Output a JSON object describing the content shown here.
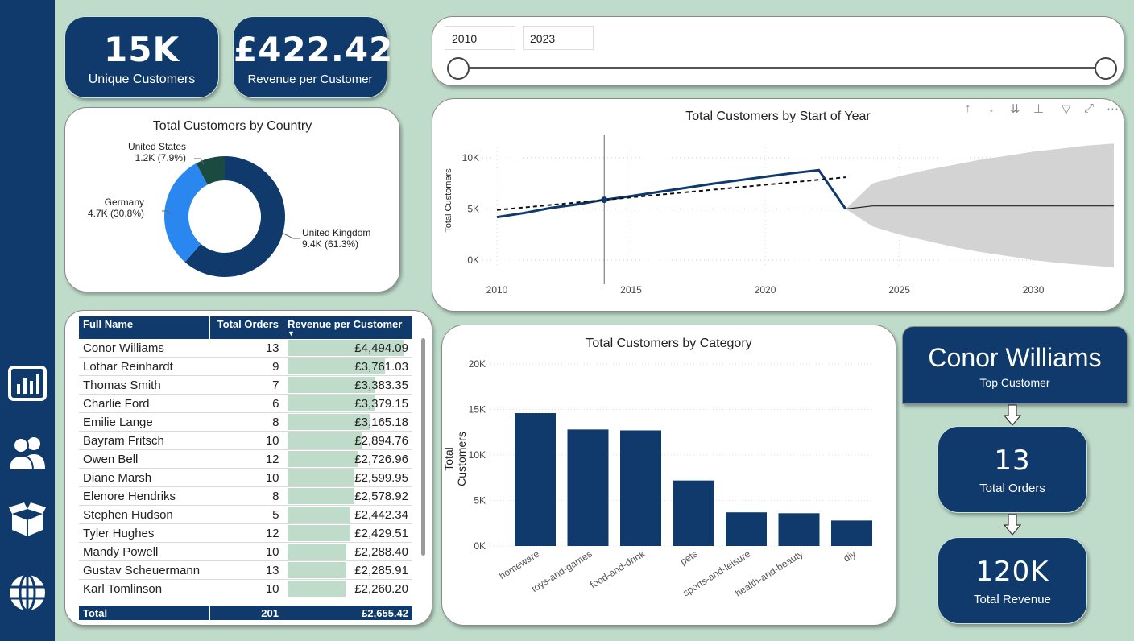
{
  "kpis": {
    "unique_customers": {
      "value": "15K",
      "label": "Unique Customers"
    },
    "revenue_per_customer": {
      "value": "£422.42",
      "label": "Revenue per Customer"
    }
  },
  "slicer": {
    "start": "2010",
    "end": "2023",
    "start_pos": 0.0,
    "end_pos": 1.0
  },
  "donut": {
    "title": "Total Customers by Country",
    "segments": [
      {
        "name": "United Kingdom",
        "label": "9.4K (61.3%)",
        "share": 0.613,
        "color": "#0f3a6b"
      },
      {
        "name": "Germany",
        "label": "4.7K (30.8%)",
        "share": 0.308,
        "color": "#2b87f0"
      },
      {
        "name": "United States",
        "label": "1.2K (7.9%)",
        "share": 0.079,
        "color": "#1a4a40"
      }
    ]
  },
  "line_chart": {
    "title": "Total Customers by Start of Year",
    "ylabel": "Total Customers",
    "yticks": [
      "0K",
      "5K",
      "10K"
    ],
    "xticks": [
      "2010",
      "2015",
      "2020",
      "2025",
      "2030"
    ]
  },
  "table": {
    "headers": [
      "Full Name",
      "Total Orders",
      "Revenue per Customer"
    ],
    "rows": [
      {
        "name": "Conor Williams",
        "orders": "13",
        "revenue": "£4,494.09",
        "rev_value": 4494.09
      },
      {
        "name": "Lothar Reinhardt",
        "orders": "9",
        "revenue": "£3,761.03",
        "rev_value": 3761.03
      },
      {
        "name": "Thomas Smith",
        "orders": "7",
        "revenue": "£3,383.35",
        "rev_value": 3383.35
      },
      {
        "name": "Charlie Ford",
        "orders": "6",
        "revenue": "£3,379.15",
        "rev_value": 3379.15
      },
      {
        "name": "Emilie Lange",
        "orders": "8",
        "revenue": "£3,165.18",
        "rev_value": 3165.18
      },
      {
        "name": "Bayram Fritsch",
        "orders": "10",
        "revenue": "£2,894.76",
        "rev_value": 2894.76
      },
      {
        "name": "Owen Bell",
        "orders": "12",
        "revenue": "£2,726.96",
        "rev_value": 2726.96
      },
      {
        "name": "Diane Marsh",
        "orders": "10",
        "revenue": "£2,599.95",
        "rev_value": 2599.95
      },
      {
        "name": "Elenore Hendriks",
        "orders": "8",
        "revenue": "£2,578.92",
        "rev_value": 2578.92
      },
      {
        "name": "Stephen Hudson",
        "orders": "5",
        "revenue": "£2,442.34",
        "rev_value": 2442.34
      },
      {
        "name": "Tyler Hughes",
        "orders": "12",
        "revenue": "£2,429.51",
        "rev_value": 2429.51
      },
      {
        "name": "Mandy Powell",
        "orders": "10",
        "revenue": "£2,288.40",
        "rev_value": 2288.4
      },
      {
        "name": "Gustav Scheuermann",
        "orders": "13",
        "revenue": "£2,285.91",
        "rev_value": 2285.91
      },
      {
        "name": "Karl Tomlinson",
        "orders": "10",
        "revenue": "£2,260.20",
        "rev_value": 2260.2
      }
    ],
    "total": {
      "label": "Total",
      "orders": "201",
      "revenue": "£2,655.42"
    }
  },
  "bar_chart": {
    "title": "Total Customers by Category",
    "ylabel": "Total Customers",
    "yticks": [
      "0K",
      "5K",
      "10K",
      "15K",
      "20K"
    ]
  },
  "top_customer": {
    "name": "Conor Williams",
    "label": "Top Customer"
  },
  "top_orders": {
    "value": "13",
    "label": "Total Orders"
  },
  "top_revenue": {
    "value": "120K",
    "label": "Total Revenue"
  },
  "icons": [
    "chart-bars-icon",
    "users-icon",
    "box-icon",
    "globe-icon",
    "sort-up-icon",
    "sort-down-icon",
    "expand-all-icon",
    "drill-icon",
    "filter-icon",
    "focus-mode-icon",
    "more-options-icon"
  ],
  "colors": {
    "navy": "#0f3a6b",
    "background": "#bfdccb",
    "blue": "#2b87f0",
    "forecast_band": "#d3d3d3"
  },
  "chart_data": [
    {
      "type": "pie",
      "title": "Total Customers by Country",
      "categories": [
        "United Kingdom",
        "Germany",
        "United States"
      ],
      "values": [
        9400,
        4700,
        1200
      ],
      "percentages": [
        61.3,
        30.8,
        7.9
      ]
    },
    {
      "type": "line",
      "title": "Total Customers by Start of Year",
      "xlabel": "",
      "ylabel": "Total Customers",
      "xlim": [
        2010,
        2033
      ],
      "ylim": [
        -1000,
        12000
      ],
      "series": [
        {
          "x": [
            2010,
            2011,
            2012,
            2013,
            2014,
            2015,
            2016,
            2017,
            2018,
            2019,
            2020,
            2021,
            2022,
            2023
          ],
          "y": [
            4200,
            4600,
            5100,
            5450,
            5900,
            6250,
            6650,
            7050,
            7450,
            7800,
            8150,
            8500,
            8800,
            5000
          ]
        },
        {
          "x": [
            2010,
            2023
          ],
          "y": [
            4900,
            8100
          ]
        },
        {
          "x": [
            2023,
            2024,
            2025,
            2026,
            2027,
            2028,
            2029,
            2030,
            2031,
            2032,
            2033
          ],
          "y": [
            5000,
            5300,
            5300,
            5300,
            5300,
            5300,
            5300,
            5300,
            5300,
            5300,
            5300
          ]
        }
      ],
      "forecast_band": {
        "x": [
          2023,
          2024,
          2025,
          2026,
          2027,
          2028,
          2029,
          2030,
          2031,
          2032,
          2033
        ],
        "upper": [
          5000,
          7500,
          8200,
          8800,
          9300,
          9800,
          10200,
          10600,
          10900,
          11200,
          11400
        ],
        "lower": [
          5000,
          3300,
          2500,
          1900,
          1300,
          800,
          400,
          0,
          -300,
          -500,
          -700
        ]
      },
      "marker": {
        "x": 2014,
        "y": 5900
      }
    },
    {
      "type": "bar",
      "title": "Total Customers by Category",
      "ylabel": "Total Customers",
      "ylim": [
        0,
        20000
      ],
      "categories": [
        "homeware",
        "toys-and-games",
        "food-and-drink",
        "pets",
        "sports-and-leisure",
        "health-and-beauty",
        "diy"
      ],
      "values": [
        14600,
        12800,
        12700,
        7200,
        3700,
        3600,
        2800
      ]
    }
  ]
}
